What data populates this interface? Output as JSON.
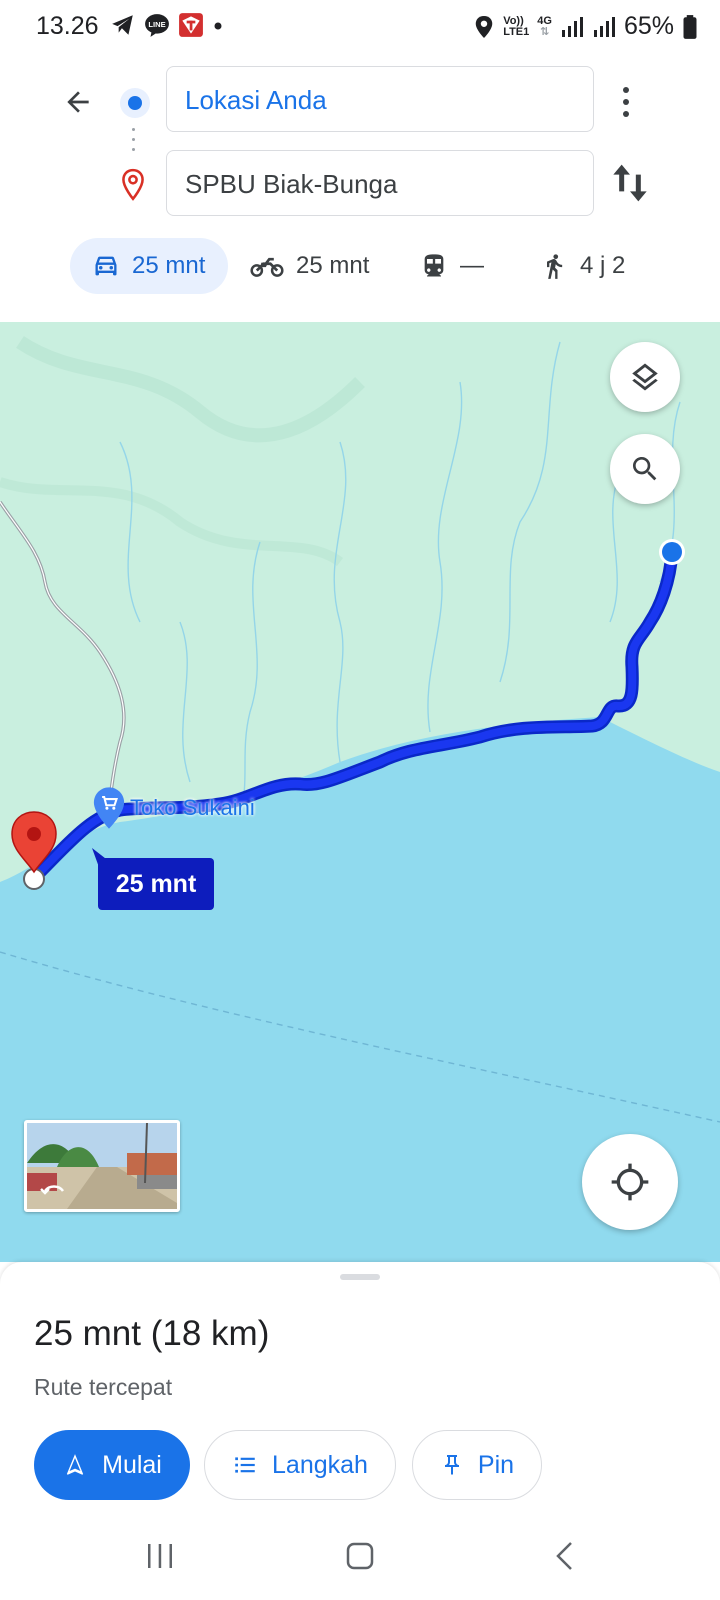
{
  "status_bar": {
    "time": "13.26",
    "network_top": "Vo))",
    "network_bottom": "LTE1",
    "network_type": "4G",
    "battery_percent": "65%",
    "icons_left": [
      "telegram-icon",
      "line-icon",
      "app-t-icon",
      "dot-icon"
    ],
    "icons_right": [
      "location-icon",
      "volte-icon",
      "signal-icon",
      "signal-icon",
      "battery-icon"
    ]
  },
  "directions": {
    "origin": "Lokasi Anda",
    "destination": "SPBU Biak-Bunga"
  },
  "modes": [
    {
      "name": "car",
      "label": "25 mnt",
      "active": true
    },
    {
      "name": "motorcycle",
      "label": "25 mnt",
      "active": false
    },
    {
      "name": "transit",
      "label": "—",
      "active": false
    },
    {
      "name": "walk",
      "label": "4 j 2",
      "active": false
    }
  ],
  "map": {
    "place_label": "Toko Sukaini",
    "duration_badge": "25 mnt",
    "colors": {
      "land": "#c9efdf",
      "water": "#90daee",
      "route": "#1a37f0",
      "badge": "#0d1dbd"
    }
  },
  "sheet": {
    "summary": "25 mnt (18 km)",
    "description": "Rute tercepat",
    "start_label": "Mulai",
    "steps_label": "Langkah",
    "pin_label": "Pin"
  },
  "accent_color": "#1a73e8"
}
